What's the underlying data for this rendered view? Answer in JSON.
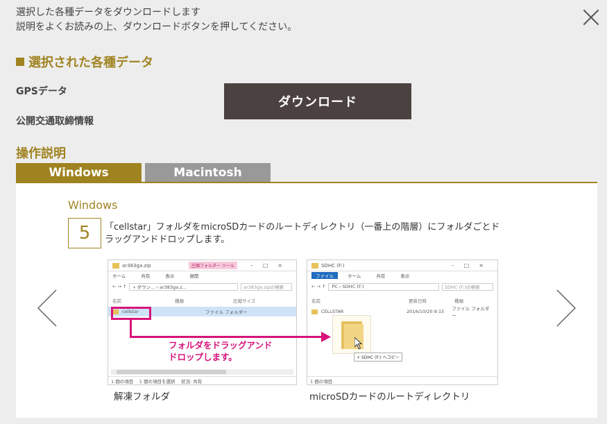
{
  "header": {
    "line1": "選択した各種データをダウンロードします",
    "line2": "説明をよくお読みの上、ダウンロードボタンを押してください。"
  },
  "selected": {
    "title": "選択された各種データ",
    "items": [
      "GPSデータ",
      "公開交通取締情報"
    ],
    "download_label": "ダウンロード"
  },
  "instructions": {
    "title": "操作説明",
    "tabs": [
      "Windows",
      "Macintosh"
    ],
    "active_tab": "Windows",
    "os_label": "Windows",
    "step_number": "5",
    "step_text": "「cellstar」フォルダをmicroSDカードのルートディレクトリ（一番上の階層）にフォルダごとドラッグアンドドロップします。",
    "drag_text_line1": "フォルダをドラッグアンド",
    "drag_text_line2": "ドロップします。",
    "caption_left": "解凍フォルダ",
    "caption_right": "microSDカードのルートディレクトリ"
  },
  "screenshot_left": {
    "title": "ar383ga.zip",
    "ribbon_tab_context": "圧縮フォルダー ツール",
    "ribbon": [
      "ホーム",
      "共有",
      "表示"
    ],
    "ribbon_right": "展開",
    "address": "« ダウン... › ar383ga.z...",
    "search": "ar383ga.zipの検索",
    "col_name": "名前",
    "col_type": "種類",
    "col_size": "圧縮サイズ",
    "row_name": "cellstar",
    "row_type": "ファイル フォルダー",
    "status": "1 個の項目　 1 個の項目を選択　 状況: 共有"
  },
  "screenshot_right": {
    "title": "SDHC (F:)",
    "ribbon_file": "ファイル",
    "ribbon": [
      "ホーム",
      "共有",
      "表示"
    ],
    "address": "PC › SDHC (F:)",
    "search": "SDHC (F:)の検索",
    "col_name": "名前",
    "col_date": "更新日時",
    "col_type": "種類",
    "row_name": "CELLSTAR",
    "row_date": "2016/10/20 9:15",
    "row_type": "ファイル フォルダー",
    "copy_tip": "+ SDHC (F:) へコピー",
    "status": "1 個の項目"
  },
  "colors": {
    "accent": "#9f8320",
    "button_bg": "#4b4140",
    "tab_inactive": "#999999",
    "highlight": "#d6137a"
  }
}
